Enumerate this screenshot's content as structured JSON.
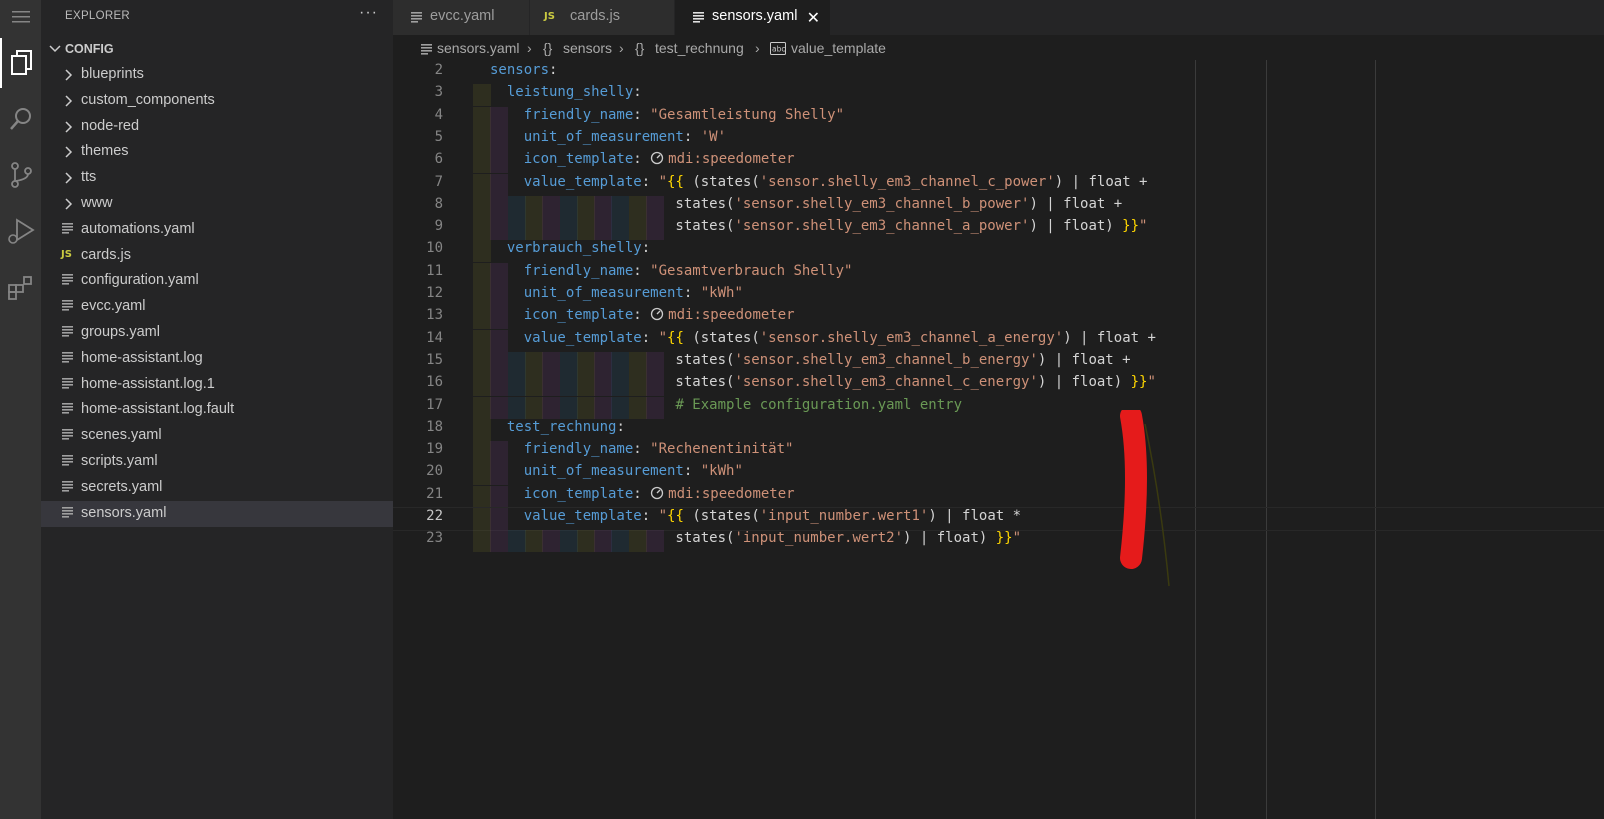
{
  "sidebar": {
    "title": "EXPLORER",
    "more": "···",
    "root": "CONFIG",
    "items": [
      {
        "label": "blueprints",
        "type": "folder"
      },
      {
        "label": "custom_components",
        "type": "folder"
      },
      {
        "label": "node-red",
        "type": "folder"
      },
      {
        "label": "themes",
        "type": "folder"
      },
      {
        "label": "tts",
        "type": "folder"
      },
      {
        "label": "www",
        "type": "folder"
      },
      {
        "label": "automations.yaml",
        "type": "file"
      },
      {
        "label": "cards.js",
        "type": "js"
      },
      {
        "label": "configuration.yaml",
        "type": "file"
      },
      {
        "label": "evcc.yaml",
        "type": "file"
      },
      {
        "label": "groups.yaml",
        "type": "file"
      },
      {
        "label": "home-assistant.log",
        "type": "file"
      },
      {
        "label": "home-assistant.log.1",
        "type": "file"
      },
      {
        "label": "home-assistant.log.fault",
        "type": "file"
      },
      {
        "label": "scenes.yaml",
        "type": "file"
      },
      {
        "label": "scripts.yaml",
        "type": "file"
      },
      {
        "label": "secrets.yaml",
        "type": "file"
      },
      {
        "label": "sensors.yaml",
        "type": "file",
        "selected": true
      }
    ]
  },
  "tabs": [
    {
      "label": "evcc.yaml",
      "type": "file"
    },
    {
      "label": "cards.js",
      "type": "js",
      "js_badge": "JS"
    },
    {
      "label": "sensors.yaml",
      "type": "file",
      "active": true,
      "close": "✕"
    }
  ],
  "js_badge": "JS",
  "breadcrumb": {
    "file": "sensors.yaml",
    "sep": "›",
    "obj_icon": "{}",
    "seg1": "sensors",
    "seg2": "test_rechnung",
    "seg3": "value_template"
  },
  "editor": {
    "lines": [
      {
        "n": "2",
        "t": "sensors:"
      },
      {
        "n": "3",
        "t": "  leistung_shelly:"
      },
      {
        "n": "4",
        "t": "    friendly_name: \"Gesamtleistung Shelly\""
      },
      {
        "n": "5",
        "t": "    unit_of_measurement: 'W'"
      },
      {
        "n": "6",
        "t": "    icon_template: mdi:speedometer"
      },
      {
        "n": "7",
        "t": "    value_template: \"{{ (states('sensor.shelly_em3_channel_c_power') | float +"
      },
      {
        "n": "8",
        "t": "                      states('sensor.shelly_em3_channel_b_power') | float +"
      },
      {
        "n": "9",
        "t": "                      states('sensor.shelly_em3_channel_a_power') | float) }}\""
      },
      {
        "n": "10",
        "t": "  verbrauch_shelly:"
      },
      {
        "n": "11",
        "t": "    friendly_name: \"Gesamtverbrauch Shelly\""
      },
      {
        "n": "12",
        "t": "    unit_of_measurement: \"kWh\""
      },
      {
        "n": "13",
        "t": "    icon_template: mdi:speedometer"
      },
      {
        "n": "14",
        "t": "    value_template: \"{{ (states('sensor.shelly_em3_channel_a_energy') | float +"
      },
      {
        "n": "15",
        "t": "                      states('sensor.shelly_em3_channel_b_energy') | float +"
      },
      {
        "n": "16",
        "t": "                      states('sensor.shelly_em3_channel_c_energy') | float) }}\""
      },
      {
        "n": "17",
        "t": "                      # Example configuration.yaml entry"
      },
      {
        "n": "18",
        "t": "  test_rechnung:"
      },
      {
        "n": "19",
        "t": "    friendly_name: \"Rechenentinität\""
      },
      {
        "n": "20",
        "t": "    unit_of_measurement: \"kWh\""
      },
      {
        "n": "21",
        "t": "    icon_template: mdi:speedometer"
      },
      {
        "n": "22",
        "t": "    value_template: \"{{ (states('input_number.wert1') | float *"
      },
      {
        "n": "23",
        "t": "                      states('input_number.wert2') | float) }}\""
      }
    ],
    "current_line": "22"
  },
  "colors": {
    "keyword": "#569cd6",
    "string": "#ce9178",
    "comment": "#6a9955",
    "bracket": "#ffd700",
    "annotation": "#e51b1b"
  },
  "icons": [
    "menu-icon",
    "files-icon",
    "search-icon",
    "source-control-icon",
    "run-debug-icon",
    "extensions-icon",
    "chevron-right-icon",
    "chevron-down-icon",
    "yaml-file-icon",
    "js-file-icon",
    "close-icon",
    "symbol-object-icon",
    "symbol-string-icon"
  ]
}
